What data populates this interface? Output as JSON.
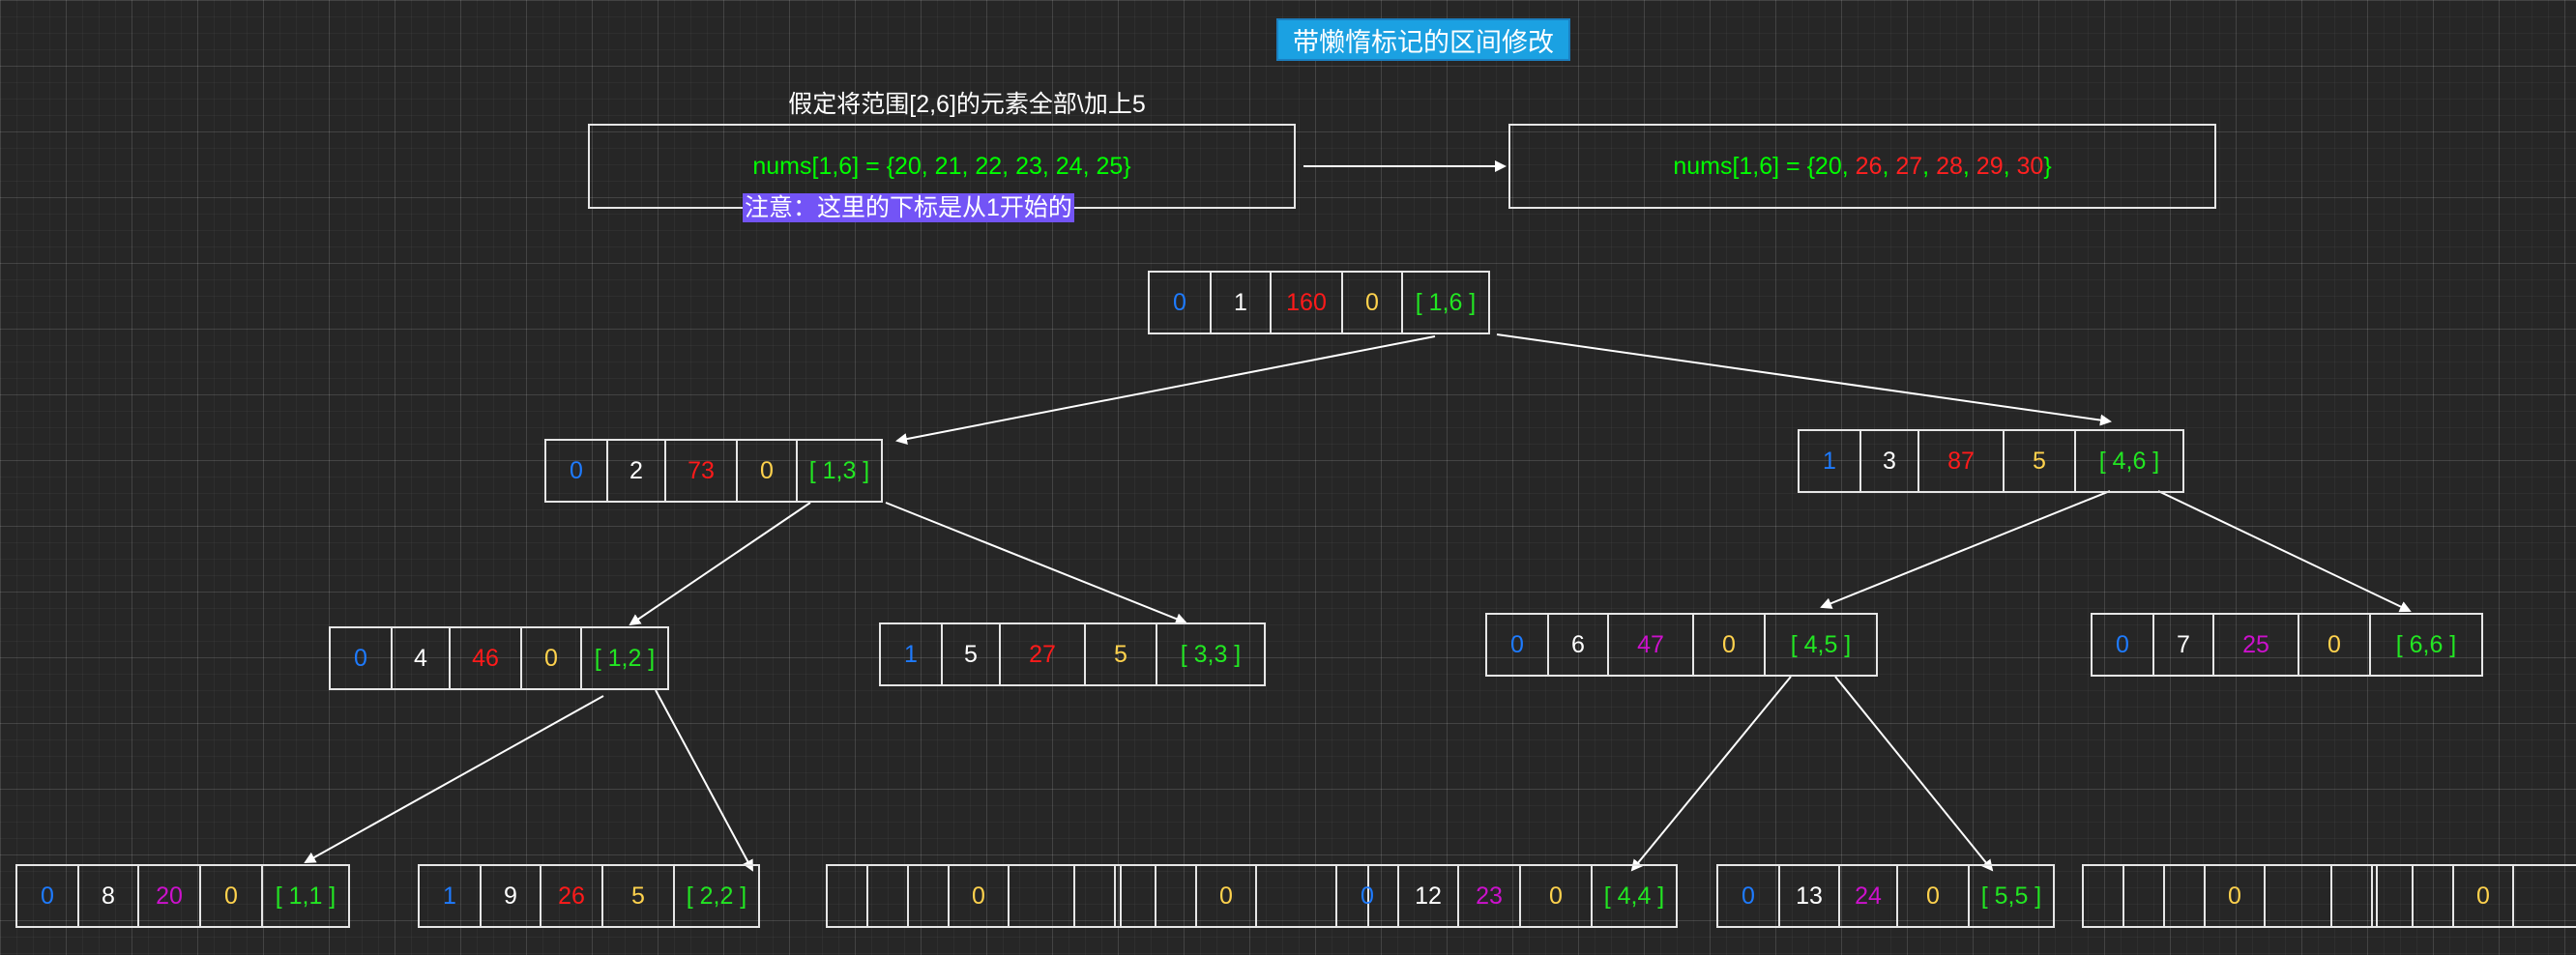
{
  "title": "带懒惰标记的区间修改",
  "caption": "假定将范围[2,6]的元素全部\\加上5",
  "nums_before": "nums[1,6] = {20, 21, 22, 23, 24, 25}",
  "nums_after_parts": [
    {
      "text": "nums[1,6] = {20, ",
      "color": "green"
    },
    {
      "text": "26",
      "color": "red"
    },
    {
      "text": ", ",
      "color": "green"
    },
    {
      "text": "27",
      "color": "red"
    },
    {
      "text": ", ",
      "color": "green"
    },
    {
      "text": "28",
      "color": "red"
    },
    {
      "text": ", ",
      "color": "green"
    },
    {
      "text": "29",
      "color": "red"
    },
    {
      "text": ", ",
      "color": "green"
    },
    {
      "text": "30",
      "color": "red"
    },
    {
      "text": "}",
      "color": "green"
    }
  ],
  "note": "注意：这里的下标是从1开始的",
  "colors": {
    "lazy": "#1e7bff",
    "index": "#ffffff",
    "sum_updated": "#ff1a1a",
    "sum_unchanged": "#cc11cc",
    "add": "#ffd24d",
    "range": "#22e622",
    "title_bg": "#1ba1e2",
    "note_bg": "#7354f6"
  },
  "tree_nodes": [
    {
      "id": "n1",
      "lazy": "0",
      "index": "1",
      "sum": "160",
      "sum_color": "red",
      "add": "0",
      "range": "[ 1,6 ]"
    },
    {
      "id": "n2",
      "lazy": "0",
      "index": "2",
      "sum": "73",
      "sum_color": "red",
      "add": "0",
      "range": "[ 1,3 ]"
    },
    {
      "id": "n3",
      "lazy": "1",
      "index": "3",
      "sum": "87",
      "sum_color": "red",
      "add": "5",
      "range": "[ 4,6 ]"
    },
    {
      "id": "n4",
      "lazy": "0",
      "index": "4",
      "sum": "46",
      "sum_color": "red",
      "add": "0",
      "range": "[ 1,2 ]"
    },
    {
      "id": "n5",
      "lazy": "1",
      "index": "5",
      "sum": "27",
      "sum_color": "red",
      "add": "5",
      "range": "[ 3,3 ]"
    },
    {
      "id": "n6",
      "lazy": "0",
      "index": "6",
      "sum": "47",
      "sum_color": "purple",
      "add": "0",
      "range": "[ 4,5 ]"
    },
    {
      "id": "n7",
      "lazy": "0",
      "index": "7",
      "sum": "25",
      "sum_color": "purple",
      "add": "0",
      "range": "[ 6,6 ]"
    },
    {
      "id": "n8",
      "lazy": "0",
      "index": "8",
      "sum": "20",
      "sum_color": "purple",
      "add": "0",
      "range": "[ 1,1 ]"
    },
    {
      "id": "n9",
      "lazy": "1",
      "index": "9",
      "sum": "26",
      "sum_color": "red",
      "add": "5",
      "range": "[ 2,2 ]"
    },
    {
      "id": "n10",
      "lazy": "",
      "index": "",
      "sum": "",
      "sum_color": "red",
      "add": "0",
      "range": ""
    },
    {
      "id": "n11",
      "lazy": "",
      "index": "",
      "sum": "",
      "sum_color": "red",
      "add": "0",
      "range": ""
    },
    {
      "id": "n12",
      "lazy": "0",
      "index": "12",
      "sum": "23",
      "sum_color": "purple",
      "add": "0",
      "range": "[ 4,4 ]"
    },
    {
      "id": "n13",
      "lazy": "0",
      "index": "13",
      "sum": "24",
      "sum_color": "purple",
      "add": "0",
      "range": "[ 5,5 ]"
    },
    {
      "id": "n14",
      "lazy": "",
      "index": "",
      "sum": "",
      "sum_color": "red",
      "add": "0",
      "range": ""
    },
    {
      "id": "n15",
      "lazy": "",
      "index": "",
      "sum": "",
      "sum_color": "red",
      "add": "0",
      "range": ""
    }
  ],
  "edges": [
    {
      "from": "n1",
      "to": "n2"
    },
    {
      "from": "n1",
      "to": "n3"
    },
    {
      "from": "n2",
      "to": "n4"
    },
    {
      "from": "n2",
      "to": "n5"
    },
    {
      "from": "n3",
      "to": "n6"
    },
    {
      "from": "n3",
      "to": "n7"
    },
    {
      "from": "n4",
      "to": "n8"
    },
    {
      "from": "n4",
      "to": "n9"
    },
    {
      "from": "n6",
      "to": "n12"
    },
    {
      "from": "n6",
      "to": "n13"
    }
  ]
}
